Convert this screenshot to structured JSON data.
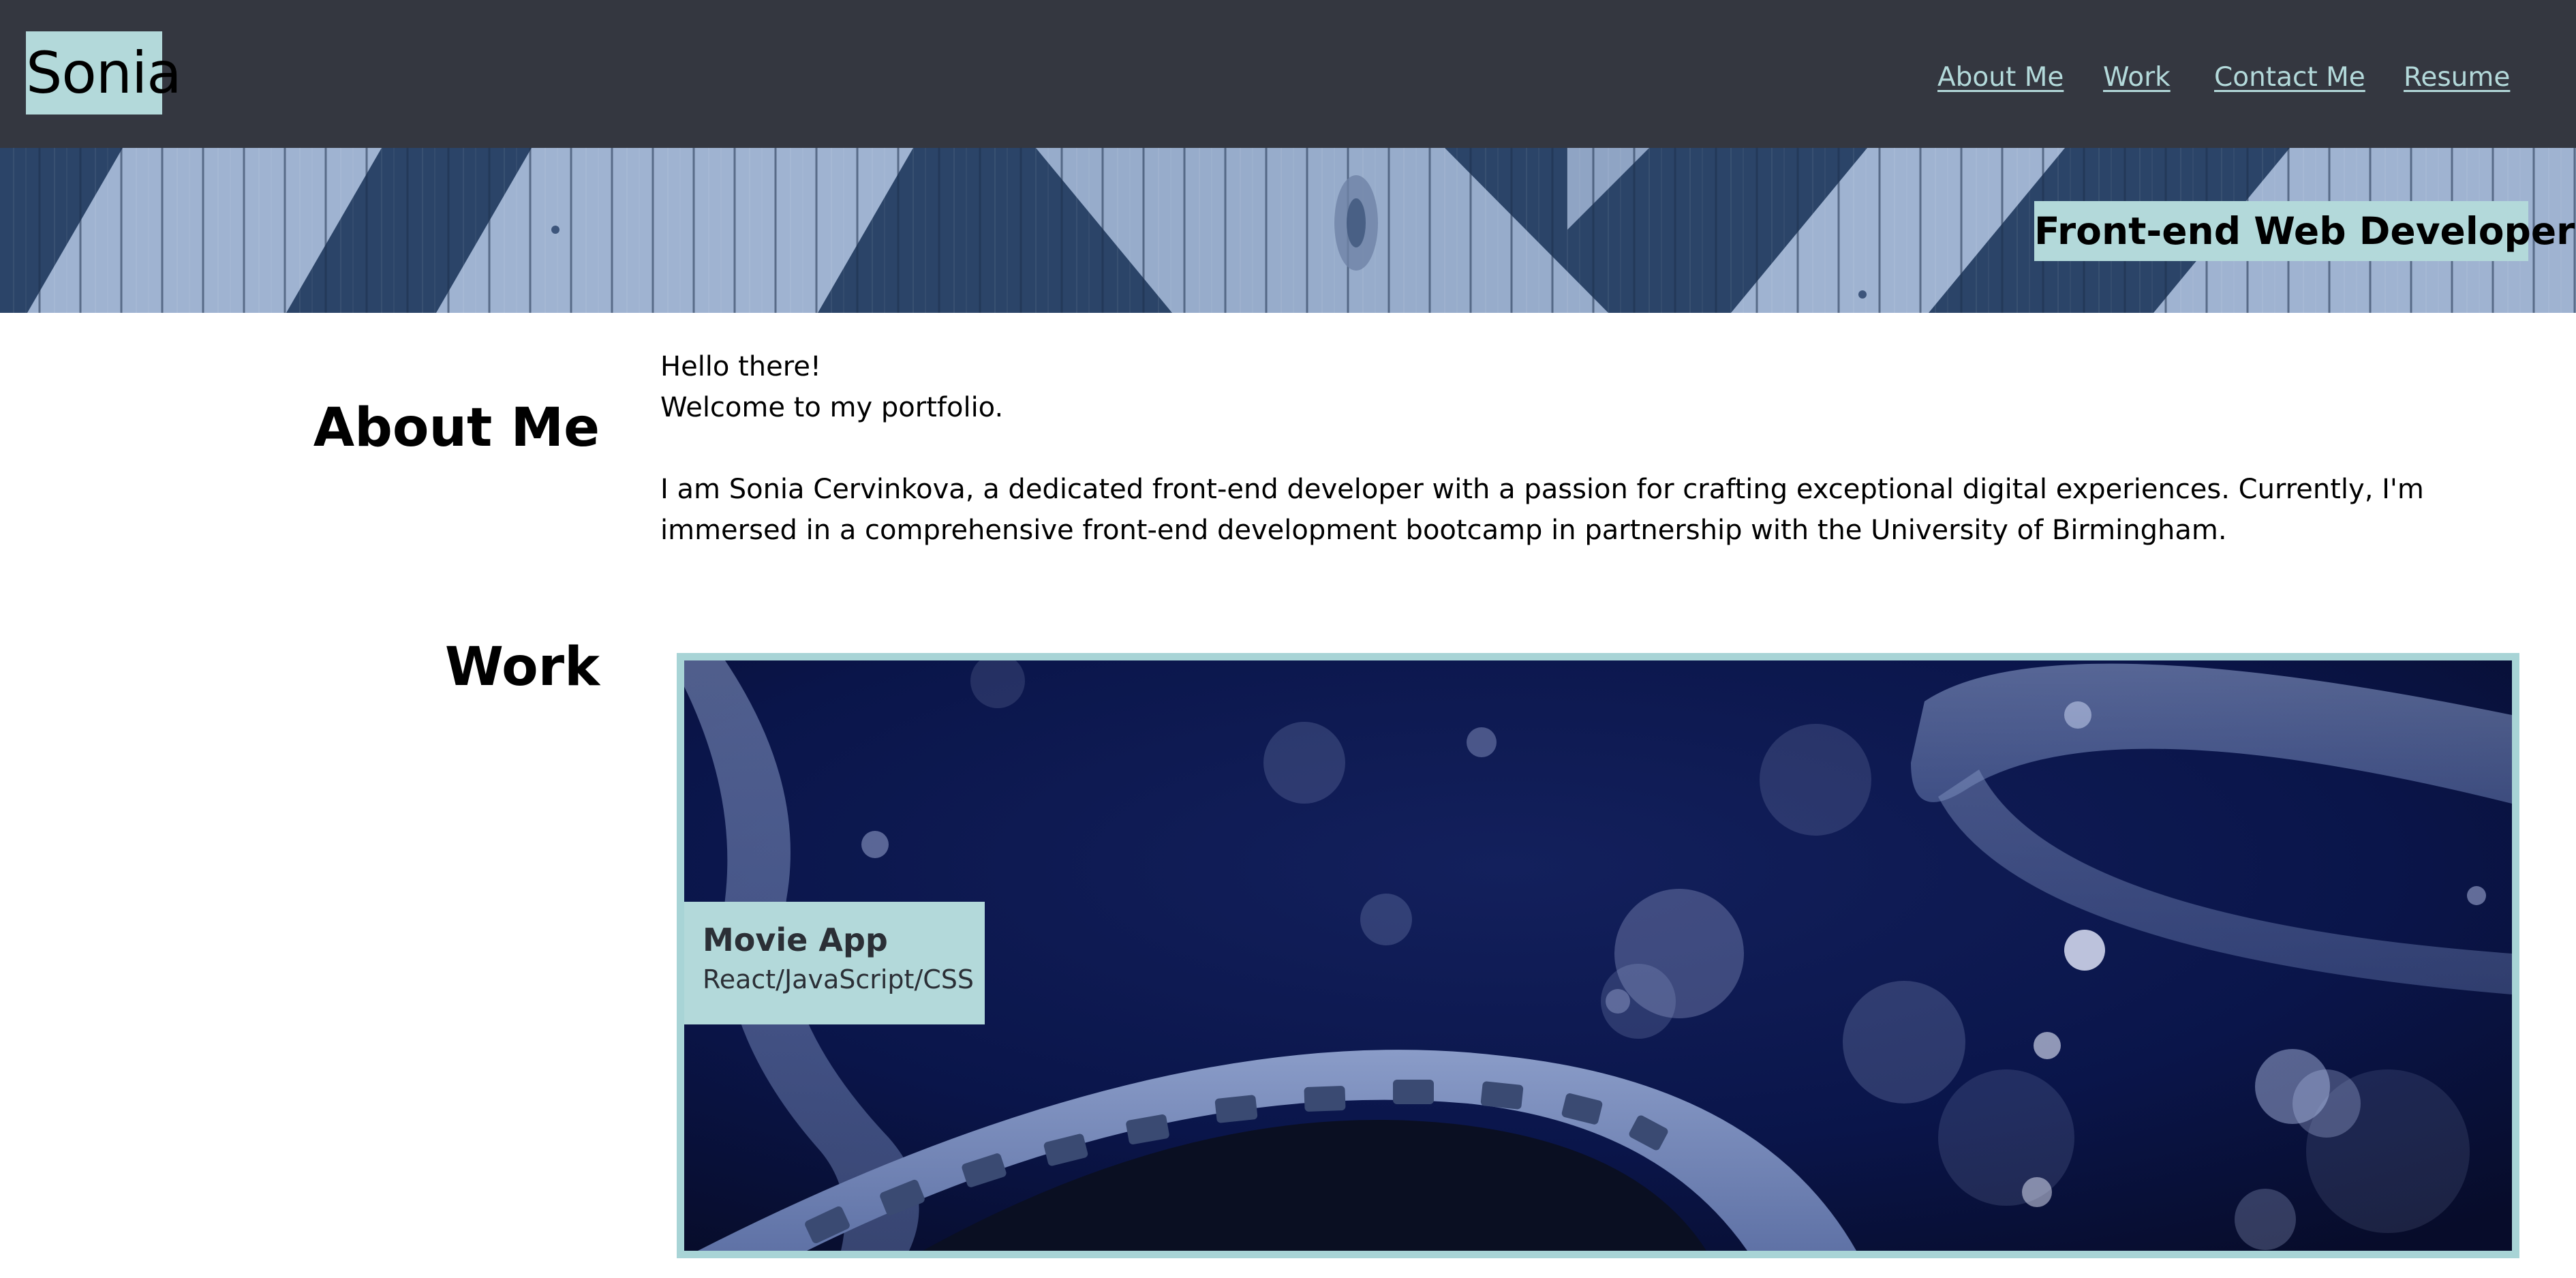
{
  "header": {
    "logo": "Sonia",
    "nav": [
      {
        "label": "About Me"
      },
      {
        "label": "Work"
      },
      {
        "label": "Contact Me"
      },
      {
        "label": "Resume"
      }
    ]
  },
  "hero": {
    "title": "Front-end Web Developer"
  },
  "about": {
    "heading": "About Me",
    "greeting": "Hello there!",
    "welcome": "Welcome to my portfolio.",
    "bio": "I am Sonia Cervinkova, a dedicated front-end developer with a passion for crafting exceptional digital experiences. Currently, I'm immersed in a comprehensive front-end development bootcamp in partnership with the University of Birmingham."
  },
  "work": {
    "heading": "Work",
    "projects": [
      {
        "title": "Movie App",
        "tech": "React/JavaScript/CSS"
      }
    ]
  },
  "colors": {
    "header_bg": "#343740",
    "accent": "#b3d9da",
    "hero_blue": "#2b4468",
    "hero_light": "#9fb3d1",
    "card_border": "#a8d4d6",
    "card_bg": "#0c1845"
  },
  "icons": [
    "wooden-fence-banner-image",
    "film-reel-project-image"
  ]
}
